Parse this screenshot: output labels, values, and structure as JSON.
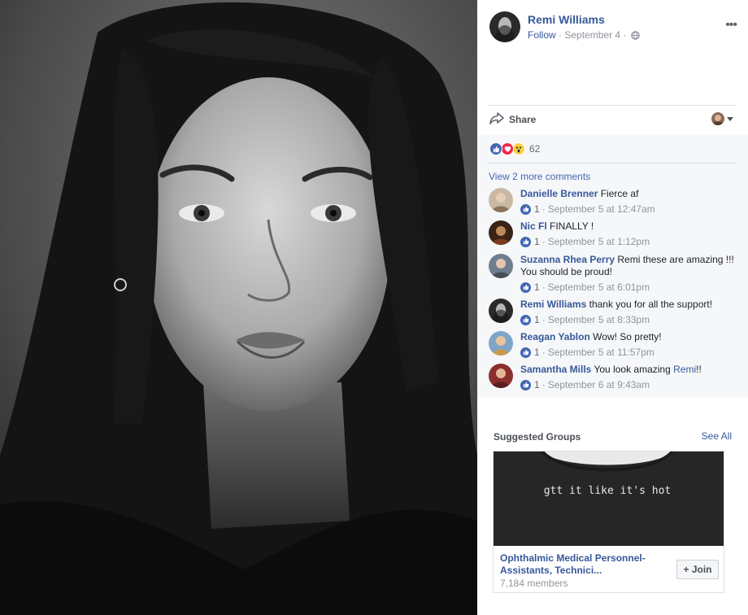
{
  "post": {
    "author": "Remi Williams",
    "follow_label": "Follow",
    "separator": " · ",
    "date": "September 4",
    "more_label": "•••"
  },
  "actions": {
    "share_label": "Share"
  },
  "reactions": {
    "count": "62",
    "types": [
      "like",
      "love",
      "wow"
    ]
  },
  "comments_section": {
    "view_more_label": "View 2 more comments",
    "items": [
      {
        "author": "Danielle Brenner",
        "text": "Fierce af",
        "likes": "1",
        "time": "September 5 at 12:47am"
      },
      {
        "author": "Nic Fl",
        "text": "FINALLY !",
        "likes": "1",
        "time": "September 5 at 1:12pm"
      },
      {
        "author": "Suzanna Rhea Perry",
        "text": "Remi these are amazing !!! You should be proud!",
        "likes": "1",
        "time": "September 5 at 6:01pm"
      },
      {
        "author": "Remi Williams",
        "text": "thank you for all the support!",
        "likes": "1",
        "time": "September 5 at 8:33pm"
      },
      {
        "author": "Reagan Yablon",
        "text": "Wow! So pretty!",
        "likes": "1",
        "time": "September 5 at 11:57pm"
      },
      {
        "author": "Samantha Mills",
        "text_before": "You look amazing ",
        "mention": "Remi",
        "text_after": "!!",
        "likes": "1",
        "time": "September 6 at 9:43am"
      }
    ]
  },
  "suggested_groups": {
    "title": "Suggested Groups",
    "see_all_label": "See All",
    "group": {
      "image_text": "gtt it like it's hot",
      "name": "Ophthalmic Medical Personnel- Assistants, Technici...",
      "members": "7,184 members",
      "join_label": "+ Join"
    }
  },
  "colors": {
    "link_blue": "#365899",
    "like_blue": "#4267b2",
    "love_red": "#f0284a",
    "wow_yellow": "#fbd148",
    "panel_gray": "#f6f7f9",
    "meta_gray": "#90949c"
  },
  "icons": [
    "globe-icon",
    "more-icon",
    "share-icon",
    "caret-down-icon",
    "like-icon",
    "love-icon",
    "wow-icon",
    "thumb-icon"
  ]
}
